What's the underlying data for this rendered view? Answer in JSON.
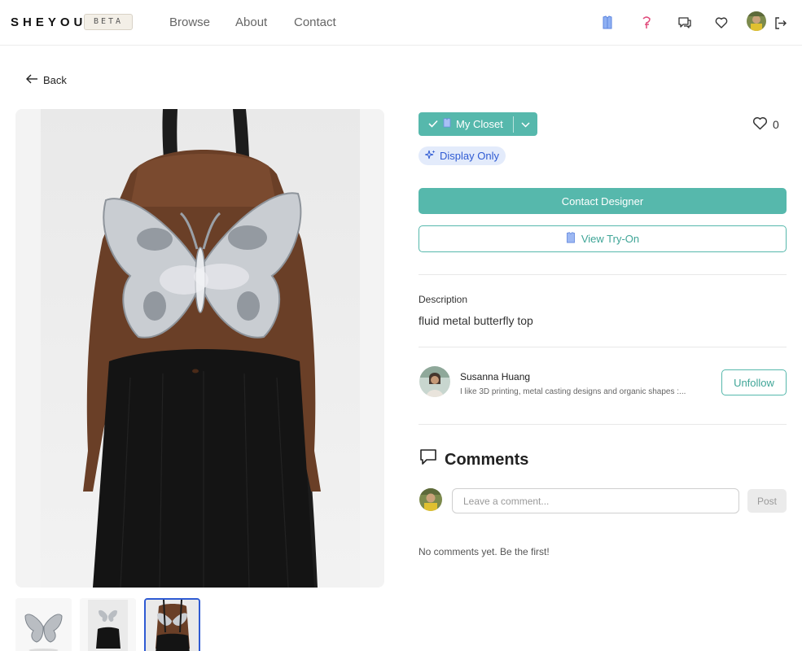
{
  "brand": {
    "name": "SHEYOU",
    "badge": "BETA"
  },
  "nav": {
    "links": [
      {
        "label": "Browse"
      },
      {
        "label": "About"
      },
      {
        "label": "Contact"
      }
    ],
    "icons": [
      "closet-icon",
      "hanger-icon",
      "chat-icon",
      "heart-icon",
      "user-avatar",
      "logout-icon"
    ]
  },
  "back": {
    "label": "Back"
  },
  "product": {
    "closet_label": "My Closet",
    "likes_count": "0",
    "display_only_label": "Display Only",
    "contact_label": "Contact Designer",
    "tryon_label": "View Try-On",
    "description_label": "Description",
    "description": "fluid metal butterfly top",
    "thumbnails": [
      {
        "name": "thumb-butterfly",
        "selected": false
      },
      {
        "name": "thumb-skirt",
        "selected": false
      },
      {
        "name": "thumb-model",
        "selected": true
      }
    ]
  },
  "designer": {
    "name": "Susanna Huang",
    "bio": "I like 3D printing, metal casting designs and organic shapes :...",
    "follow_label": "Unfollow"
  },
  "comments": {
    "title": "Comments",
    "placeholder": "Leave a comment...",
    "post_label": "Post",
    "empty_text": "No comments yet. Be the first!"
  },
  "colors": {
    "accent": "#56b8ac",
    "badge_blue": "#2f5bd3",
    "badge_bg": "#e3ebfb"
  }
}
